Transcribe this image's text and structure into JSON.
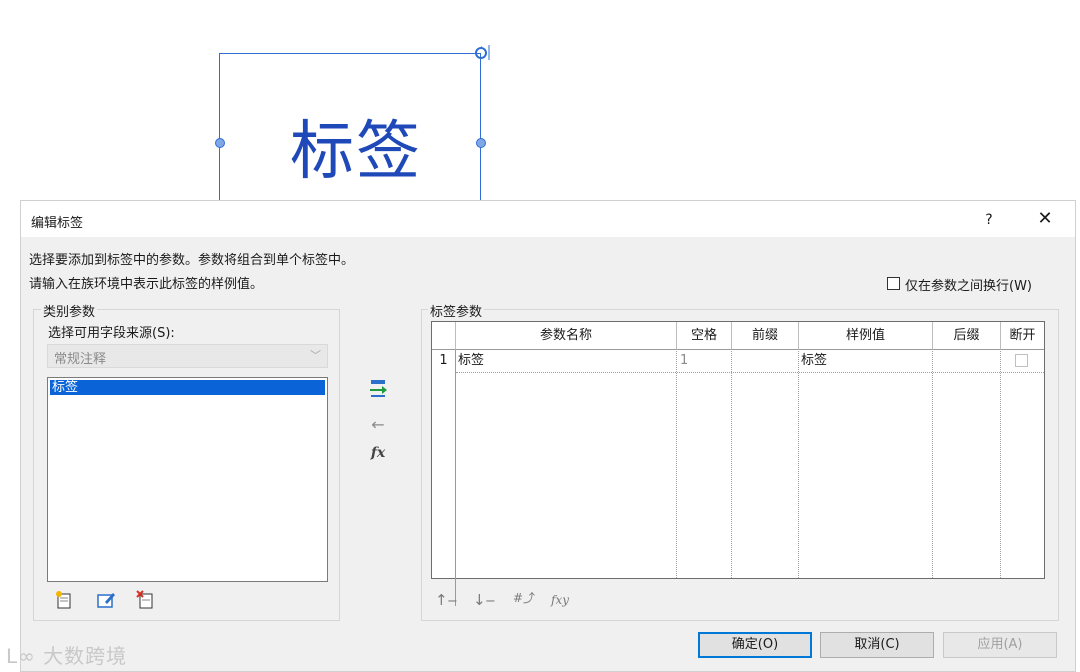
{
  "preview": {
    "label_text": "标签"
  },
  "dialog": {
    "title": "编辑标签",
    "help_label": "?",
    "close_label": "✕",
    "instruction_line1": "选择要添加到标签中的参数。参数将组合到单个标签中。",
    "instruction_line2": "请输入在族环境中表示此标签的样例值。",
    "wrap_option_label": "仅在参数之间换行(W)",
    "wrap_option_checked": false
  },
  "category_params": {
    "group_title": "类别参数",
    "source_label": "选择可用字段来源(S):",
    "source_selected": "常规注释",
    "fields": [
      "标签"
    ]
  },
  "label_params": {
    "group_title": "标签参数",
    "columns": [
      "参数名称",
      "空格",
      "前缀",
      "样例值",
      "后缀",
      "断开"
    ],
    "rows": [
      {
        "index": "1",
        "name": "标签",
        "spaces": "1",
        "prefix": "",
        "sample": "标签",
        "suffix": "",
        "break": false
      }
    ]
  },
  "buttons": {
    "ok": "确定(O)",
    "cancel": "取消(C)",
    "apply": "应用(A)"
  },
  "watermark": "大数跨境",
  "colors": {
    "selection": "#0a64d8",
    "preview_text": "#1f49b8",
    "frame": "#2f6ed4"
  }
}
